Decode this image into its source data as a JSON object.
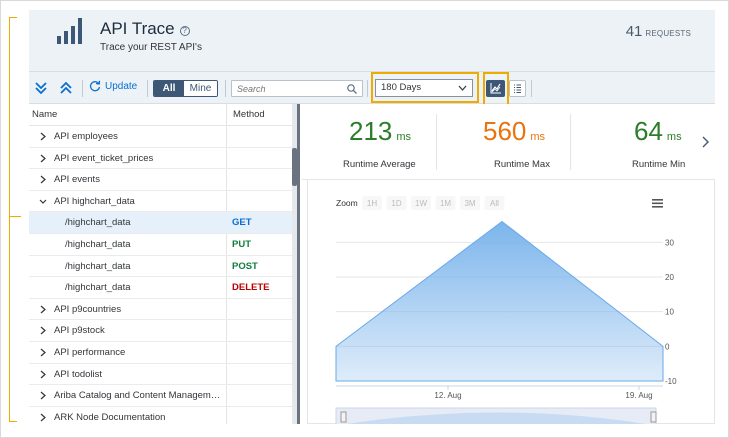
{
  "header": {
    "title": "API Trace",
    "subtitle": "Trace your REST API's",
    "request_count": "41",
    "request_label": "REQUESTS"
  },
  "toolbar": {
    "update_label": "Update",
    "segment_all": "All",
    "segment_mine": "Mine",
    "search_placeholder": "Search",
    "period_value": "180 Days"
  },
  "table": {
    "columns": [
      "Name",
      "Method"
    ],
    "rows": [
      {
        "name": "API employees",
        "method": "",
        "level": 0,
        "expanded": false
      },
      {
        "name": "API event_ticket_prices",
        "method": "",
        "level": 0,
        "expanded": false
      },
      {
        "name": "API events",
        "method": "",
        "level": 0,
        "expanded": false
      },
      {
        "name": "API highchart_data",
        "method": "",
        "level": 0,
        "expanded": true
      },
      {
        "name": "/highchart_data",
        "method": "GET",
        "level": 1,
        "selected": true
      },
      {
        "name": "/highchart_data",
        "method": "PUT",
        "level": 1
      },
      {
        "name": "/highchart_data",
        "method": "POST",
        "level": 1
      },
      {
        "name": "/highchart_data",
        "method": "DELETE",
        "level": 1
      },
      {
        "name": "API p9countries",
        "method": "",
        "level": 0,
        "expanded": false
      },
      {
        "name": "API p9stock",
        "method": "",
        "level": 0,
        "expanded": false
      },
      {
        "name": "API performance",
        "method": "",
        "level": 0,
        "expanded": false
      },
      {
        "name": "API todolist",
        "method": "",
        "level": 0,
        "expanded": false
      },
      {
        "name": "Ariba Catalog and Content Manageme...",
        "method": "",
        "level": 0,
        "expanded": false
      },
      {
        "name": "ARK Node Documentation",
        "method": "",
        "level": 0,
        "expanded": false
      }
    ],
    "method_colors": {
      "GET": "#0a6ed1",
      "PUT": "#107e3e",
      "POST": "#107e3e",
      "DELETE": "#bb0000"
    }
  },
  "kpis": [
    {
      "value": "213",
      "unit": "ms",
      "label": "Runtime Average",
      "color": "#2b7d2b"
    },
    {
      "value": "560",
      "unit": "ms",
      "label": "Runtime Max",
      "color": "#e9730c"
    },
    {
      "value": "64",
      "unit": "ms",
      "label": "Runtime Min",
      "color": "#2b7d2b"
    }
  ],
  "chart": {
    "zoom_label": "Zoom",
    "zoom_buttons": [
      "1H",
      "1D",
      "1W",
      "1M",
      "3M",
      "All"
    ],
    "menu_icon": "hamburger-icon"
  },
  "chart_data": {
    "type": "area",
    "y_ticks": [
      30,
      20,
      10,
      0,
      -10
    ],
    "ylim": [
      -10,
      35
    ],
    "x_ticks": [
      "12. Aug",
      "19. Aug"
    ],
    "series": [
      {
        "values": [
          {
            "x": "start",
            "y": 0
          },
          {
            "x": "peak",
            "y": 36
          },
          {
            "x": "end",
            "y": 0
          }
        ]
      }
    ],
    "color": "#7cb5ec"
  }
}
